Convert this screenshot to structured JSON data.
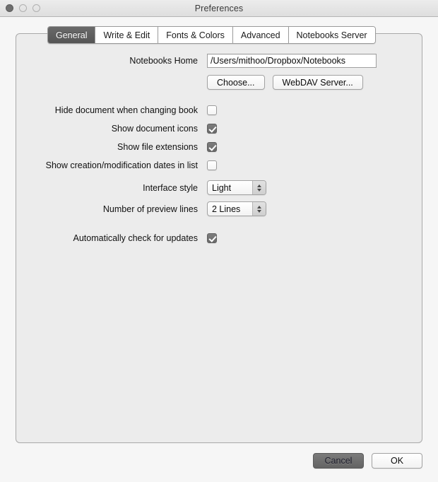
{
  "window": {
    "title": "Preferences",
    "traffic_lights": [
      {
        "name": "close",
        "state": "filled"
      },
      {
        "name": "minimize",
        "state": "outline"
      },
      {
        "name": "zoom",
        "state": "outline"
      }
    ]
  },
  "tabs": [
    {
      "label": "General",
      "active": true
    },
    {
      "label": "Write & Edit",
      "active": false
    },
    {
      "label": "Fonts & Colors",
      "active": false
    },
    {
      "label": "Advanced",
      "active": false
    },
    {
      "label": "Notebooks Server",
      "active": false
    }
  ],
  "general": {
    "home": {
      "label": "Notebooks Home",
      "value": "/Users/mithoo/Dropbox/Notebooks",
      "placeholder": "/Users/mithoo/Dropbox/Notebooks"
    },
    "buttons": {
      "choose": "Choose...",
      "webdav": "WebDAV Server..."
    },
    "checkboxes": [
      {
        "label": "Hide document when changing book",
        "checked": false
      },
      {
        "label": "Show document icons",
        "checked": true
      },
      {
        "label": "Show file extensions",
        "checked": true
      },
      {
        "label": "Show creation/modification dates in list",
        "checked": false
      }
    ],
    "popups": [
      {
        "label": "Interface style",
        "value": "Light"
      },
      {
        "label": "Number of preview lines",
        "value": "2 Lines"
      }
    ],
    "updates": {
      "label": "Automatically check for updates",
      "checked": true
    }
  },
  "footer": {
    "cancel": "Cancel",
    "ok": "OK"
  },
  "colors": {
    "window_bg": "#f6f6f6",
    "panel_bg": "#ececec",
    "accent_dark": "#5a5a5a",
    "border": "#a9a9a9"
  }
}
